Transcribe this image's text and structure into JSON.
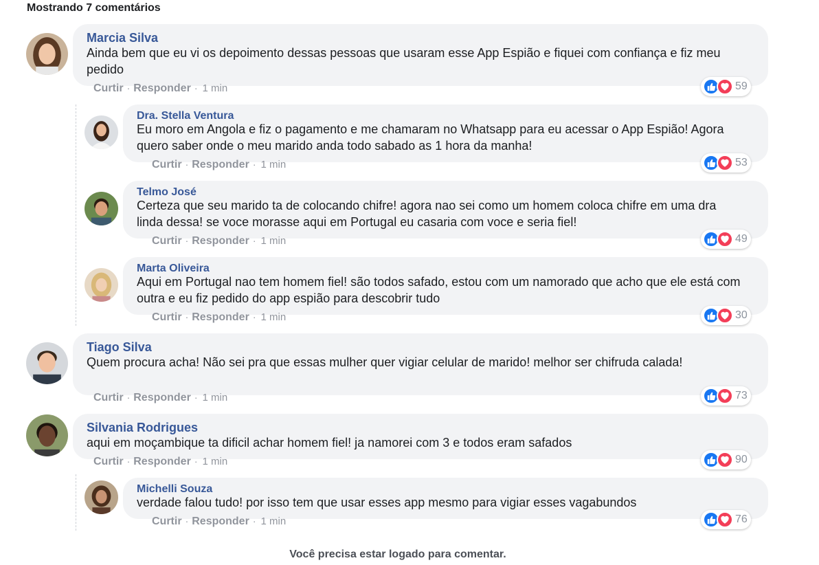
{
  "header": {
    "count_label": "Mostrando 7 comentários"
  },
  "labels": {
    "like": "Curtir",
    "reply": "Responder",
    "separator": "·"
  },
  "reaction_colors": {
    "like": "#1877f2",
    "love": "#f33e58"
  },
  "comments": [
    {
      "author": "Marcia Silva",
      "text": "Ainda bem que eu vi os depoimento dessas pessoas que usaram esse App Espião e fiquei com confiança e fiz meu pedido",
      "time": "1 min",
      "reactions": "59"
    },
    {
      "author": "Dra. Stella Ventura",
      "text": "Eu moro em Angola e fiz o pagamento e me chamaram no Whatsapp para eu acessar o App Espião! Agora quero saber onde o meu marido anda todo sabado as 1 hora da manha!",
      "time": "1 min",
      "reactions": "53"
    },
    {
      "author": "Telmo José",
      "text": "Certeza que seu marido ta de colocando chifre! agora nao sei como um homem coloca chifre em uma dra linda dessa! se voce morasse aqui em Portugal eu casaria com voce e seria fiel!",
      "time": "1 min",
      "reactions": "49"
    },
    {
      "author": "Marta Oliveira",
      "text": "Aqui em Portugal nao tem homem fiel! são todos safado, estou com um namorado que acho que ele está com outra e eu fiz pedido do app espião para descobrir tudo",
      "time": "1 min",
      "reactions": "30"
    },
    {
      "author": "Tiago Silva",
      "text": "Quem procura acha! Não sei pra que essas mulher quer vigiar celular de marido! melhor ser chifruda calada!",
      "time": "1 min",
      "reactions": "73"
    },
    {
      "author": "Silvania Rodrigues",
      "text": "aqui em moçambique ta dificil achar homem fiel! ja namorei com 3 e todos eram safados",
      "time": "1 min",
      "reactions": "90"
    },
    {
      "author": "Michelli Souza",
      "text": "verdade falou tudo! por isso tem que usar esses app mesmo para vigiar esses vagabundos",
      "time": "1 min",
      "reactions": "76"
    }
  ],
  "footer": {
    "login_notice": "Você precisa estar logado para comentar."
  }
}
